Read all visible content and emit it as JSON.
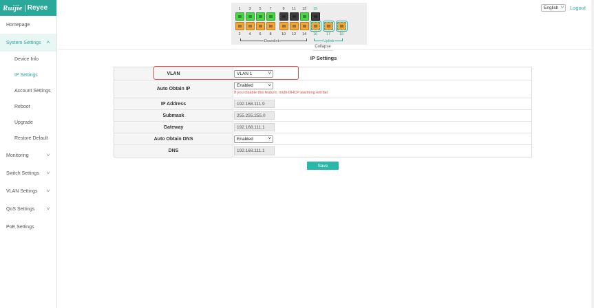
{
  "brand": {
    "left": "Ruijie",
    "right": "Reyee",
    "color": "#2aa89a"
  },
  "header": {
    "language": "English",
    "logout": "Logout"
  },
  "sidebar": {
    "items": [
      {
        "label": "Homepage"
      },
      {
        "label": "System Settings",
        "sub": [
          "Device Info",
          "IP Settings",
          "Account Settings",
          "Reboot",
          "Upgrade",
          "Restore Default"
        ]
      },
      {
        "label": "Monitoring"
      },
      {
        "label": "Switch Settings"
      },
      {
        "label": "VLAN Settings"
      },
      {
        "label": "QoS Settings"
      },
      {
        "label": "PoE Settings"
      }
    ],
    "active": "IP Settings"
  },
  "ports": {
    "top_numbers": [
      "1",
      "3",
      "5",
      "7",
      "9",
      "11",
      "13",
      "15"
    ],
    "bottom_numbers": [
      "2",
      "4",
      "6",
      "8",
      "10",
      "12",
      "14",
      "16",
      "17",
      "18"
    ],
    "downlink_label": "Downlink",
    "uplink_label": "Uplink",
    "collapse_label": "Collapse"
  },
  "page": {
    "title": "IP Settings"
  },
  "form": {
    "vlan": {
      "label": "VLAN",
      "value": "VLAN 1"
    },
    "auto_obtain_ip": {
      "label": "Auto Obtain IP",
      "value": "Enabled",
      "warning": "If you disable this feature, multi-DHCP alarming will fail."
    },
    "ip_address": {
      "label": "IP Address",
      "value": "192.168.111.9"
    },
    "submask": {
      "label": "Submask",
      "value": "255.255.255.0"
    },
    "gateway": {
      "label": "Gateway",
      "value": "192.168.111.1"
    },
    "auto_obtain_dns": {
      "label": "Auto Obtain DNS",
      "value": "Enabled"
    },
    "dns": {
      "label": "DNS",
      "value": "192.168.111.1"
    }
  },
  "actions": {
    "save": "Save"
  }
}
